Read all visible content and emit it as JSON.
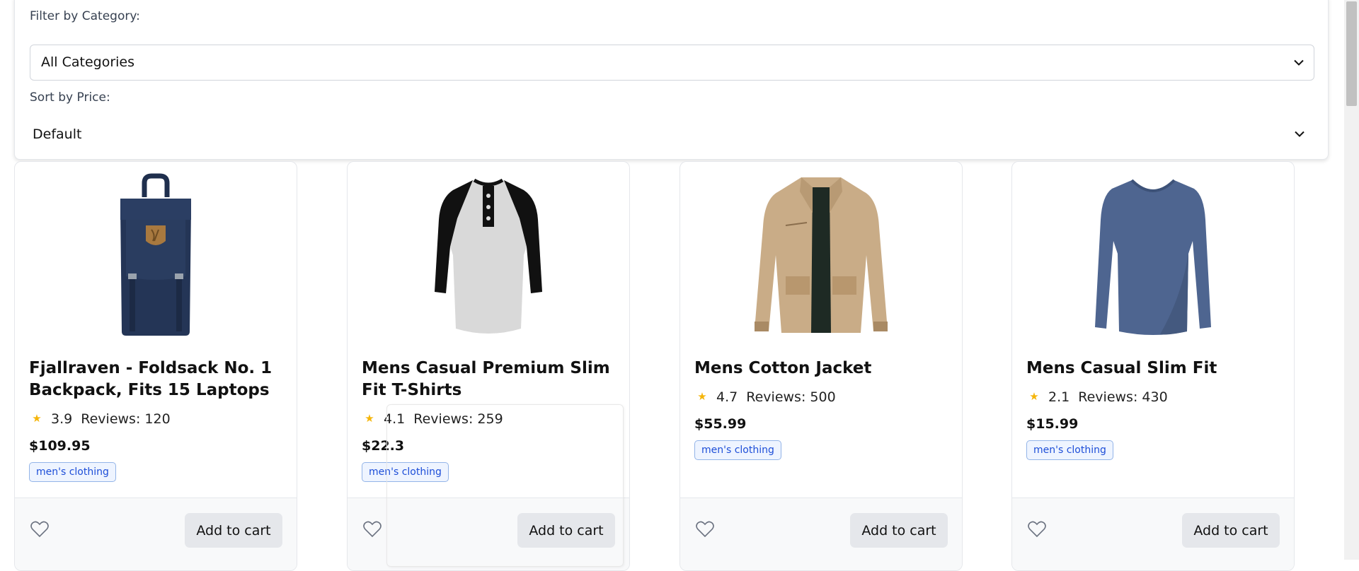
{
  "filters": {
    "category_label": "Filter by Category:",
    "category_value": "All Categories",
    "sort_label": "Sort by Price:",
    "sort_value": "Default"
  },
  "products": [
    {
      "title": "Fjallraven - Foldsack No. 1 Backpack, Fits 15 Laptops",
      "rating": "3.9",
      "reviews": "Reviews: 120",
      "price": "$109.95",
      "category": "men's clothing",
      "image_icon": "backpack-image",
      "cart_label": "Add to cart"
    },
    {
      "title": "Mens Casual Premium Slim Fit T-Shirts",
      "rating": "4.1",
      "reviews": "Reviews: 259",
      "price": "$22.3",
      "category": "men's clothing",
      "image_icon": "raglan-tshirt-image",
      "cart_label": "Add to cart"
    },
    {
      "title": "Mens Cotton Jacket",
      "rating": "4.7",
      "reviews": "Reviews: 500",
      "price": "$55.99",
      "category": "men's clothing",
      "image_icon": "cotton-jacket-image",
      "cart_label": "Add to cart"
    },
    {
      "title": "Mens Casual Slim Fit",
      "rating": "2.1",
      "reviews": "Reviews: 430",
      "price": "$15.99",
      "category": "men's clothing",
      "image_icon": "longsleeve-shirt-image",
      "cart_label": "Add to cart"
    }
  ],
  "colors": {
    "star": "#f5b50a",
    "badge_text": "#1d4ed8",
    "badge_border": "#93b4e8",
    "cart_button": "#e5e7eb"
  }
}
